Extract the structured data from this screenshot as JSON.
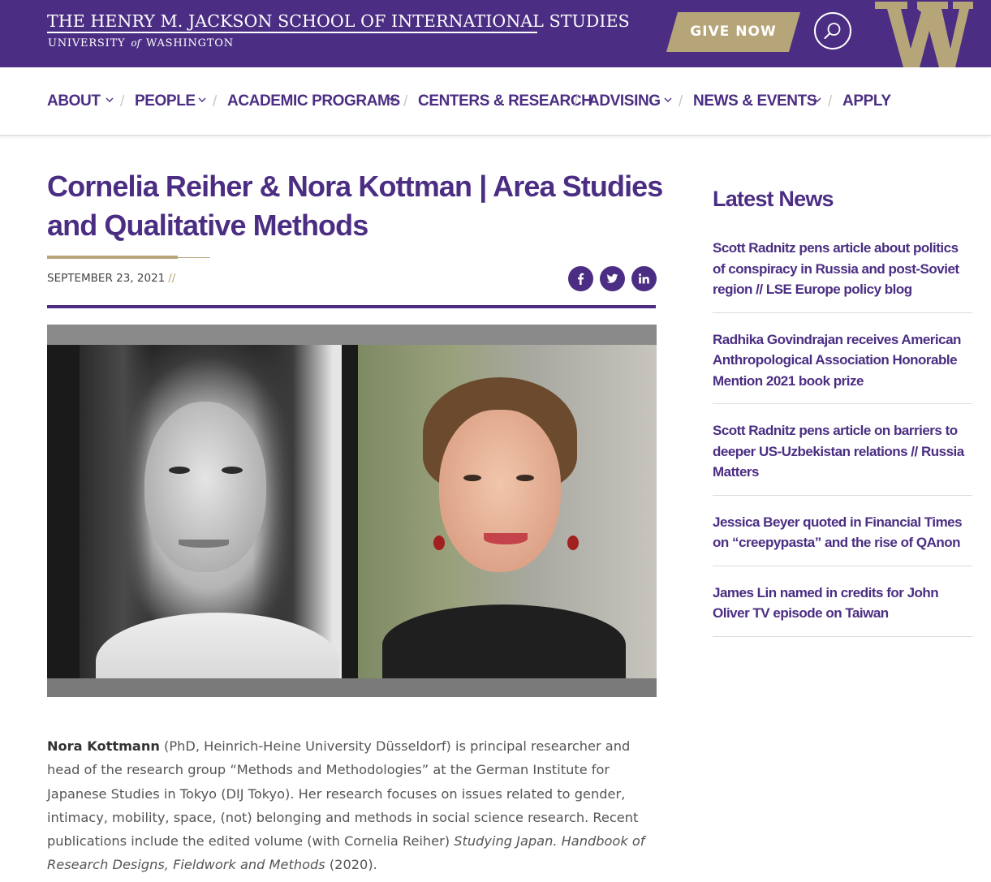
{
  "header": {
    "site_title": "THE HENRY M. JACKSON SCHOOL OF INTERNATIONAL STUDIES",
    "university_pre": "UNIVERSITY",
    "university_of": "of",
    "university_post": "WASHINGTON",
    "give_now_label": "GIVE NOW",
    "search_icon": "search-icon",
    "logo_letter": "W"
  },
  "nav": {
    "items": [
      {
        "label": "ABOUT",
        "has_dropdown": true
      },
      {
        "label": "PEOPLE",
        "has_dropdown": true
      },
      {
        "label": "ACADEMIC PROGRAMS",
        "has_dropdown": true
      },
      {
        "label": "CENTERS & RESEARCH",
        "has_dropdown": false
      },
      {
        "label": "ADVISING",
        "has_dropdown": true
      },
      {
        "label": "NEWS & EVENTS",
        "has_dropdown": true
      },
      {
        "label": "APPLY",
        "has_dropdown": false
      }
    ],
    "separator": "/"
  },
  "article": {
    "title": "Cornelia Reiher & Nora Kottman | Area Studies and Qualitative Methods",
    "date": "SEPTEMBER 23, 2021",
    "date_suffix": "//",
    "share": [
      "facebook-icon",
      "twitter-icon",
      "linkedin-icon"
    ],
    "body": {
      "name": "Nora Kottmann",
      "text_1": " (PhD, Heinrich-Heine University Düsseldorf) is principal researcher and head of the research group “Methods and Methodologies” at the German Institute for Japanese Studies in Tokyo (DIJ Tokyo). Her research focuses on issues related to gender, intimacy, mobility, space, (not) belonging and methods in social science research. Recent publications include the edited volume (with Cornelia Reiher) ",
      "book": "Studying Japan. Handbook of Research Designs, Fieldwork and Methods",
      "text_2": " (2020)."
    }
  },
  "sidebar": {
    "heading": "Latest News",
    "news": [
      "Scott Radnitz pens article about politics of conspiracy in Russia and post-Soviet region // LSE Europe policy blog",
      "Radhika Govindrajan receives American Anthropological Association Honorable Mention 2021 book prize",
      "Scott Radnitz pens article on barriers to deeper US-Uzbekistan relations // Russia Matters",
      "Jessica Beyer quoted in Financial Times on “creepypasta” and the rise of QAnon",
      "James Lin named in credits for John Oliver TV episode on Taiwan"
    ]
  },
  "colors": {
    "brand_purple": "#4b2e83",
    "brand_gold": "#b7a57a"
  }
}
